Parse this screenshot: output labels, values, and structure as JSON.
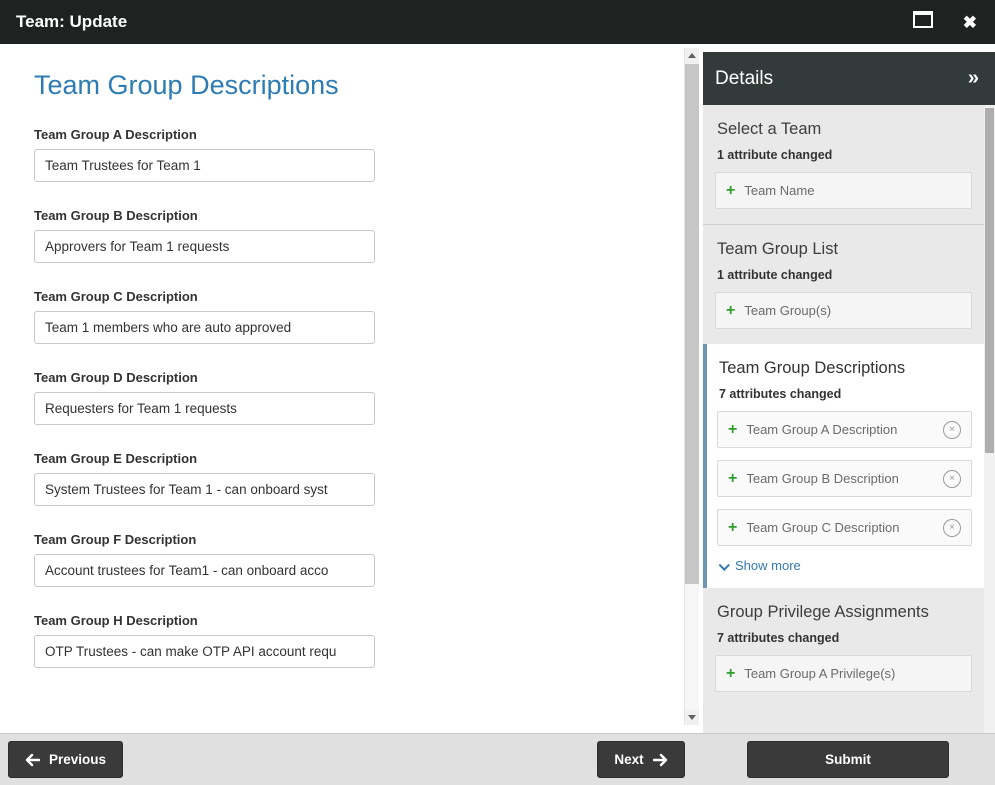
{
  "window": {
    "title": "Team: Update"
  },
  "theme": {
    "heading_color": "#2d7cb3",
    "titlebar_color": "#1e2322",
    "details_header_color": "#323a3a",
    "accent_stripe_color": "#6d96b2",
    "plus_color": "#2f9e2f",
    "link_color": "#337ab0",
    "button_color": "#3a3a3a"
  },
  "main": {
    "heading": "Team Group Descriptions",
    "fields": [
      {
        "label": "Team Group A Description",
        "value": "Team Trustees for Team 1"
      },
      {
        "label": "Team Group B Description",
        "value": "Approvers for Team 1 requests"
      },
      {
        "label": "Team Group C Description",
        "value": "Team 1 members who are auto approved"
      },
      {
        "label": "Team Group D Description",
        "value": "Requesters for Team 1 requests"
      },
      {
        "label": "Team Group E Description",
        "value": "System Trustees for Team 1 - can onboard syst"
      },
      {
        "label": "Team Group F Description",
        "value": "Account trustees for Team1 - can onboard acco"
      },
      {
        "label": "Team Group H Description",
        "value": "OTP Trustees - can make OTP API account requ"
      }
    ]
  },
  "sidebar": {
    "header": {
      "title": "Details",
      "collapse_icon": "»"
    },
    "sections": [
      {
        "title": "Select a Team",
        "status": "1 attribute changed",
        "items": [
          {
            "label": "Team Name"
          }
        ]
      },
      {
        "title": "Team Group List",
        "status": "1 attribute changed",
        "items": [
          {
            "label": "Team Group(s)"
          }
        ]
      },
      {
        "title": "Team Group Descriptions",
        "status": "7 attributes changed",
        "items": [
          {
            "label": "Team Group A Description"
          },
          {
            "label": "Team Group B Description"
          },
          {
            "label": "Team Group C Description"
          }
        ],
        "show_more": "Show more"
      },
      {
        "title": "Group Privilege Assignments",
        "status": "7 attributes changed",
        "items": [
          {
            "label": "Team Group A Privilege(s)"
          }
        ]
      }
    ]
  },
  "footer": {
    "previous_label": "Previous",
    "next_label": "Next",
    "submit_label": "Submit"
  },
  "glyphs": {
    "close": "✖",
    "plus": "+",
    "remove": "×"
  }
}
